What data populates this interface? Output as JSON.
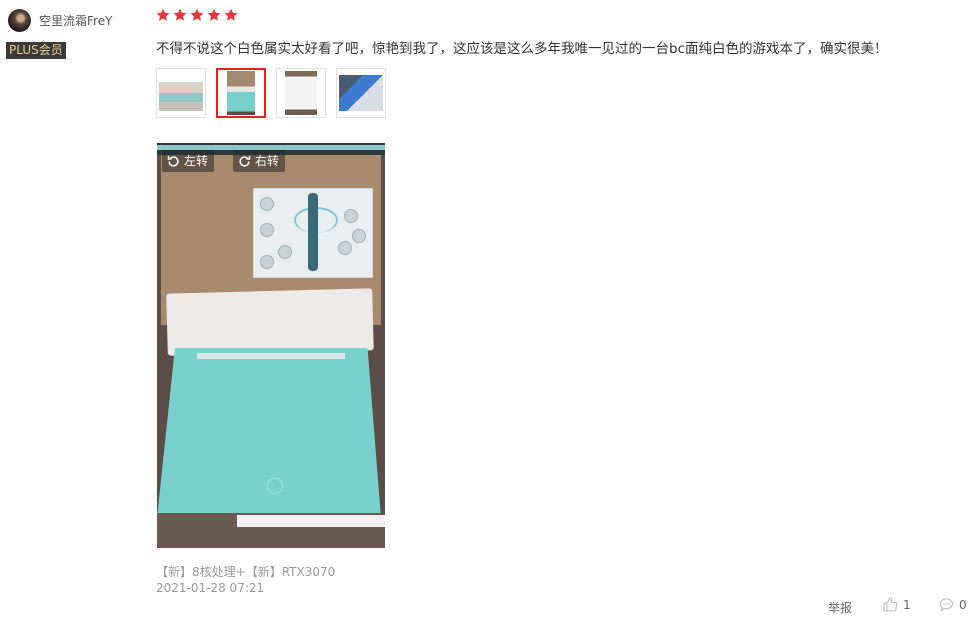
{
  "user": {
    "name": "空里流霜FreY",
    "badge": "PLUS会员"
  },
  "review": {
    "rating": 5,
    "rating_max": 5,
    "star_color": "#e4393c",
    "text": "不得不说这个白色属实太好看了吧，惊艳到我了，这应该是这么多年我唯一见过的一台bc面纯白色的游戏本了，确实很美！"
  },
  "gallery": {
    "thumbnail_count": 4,
    "active_index": 1,
    "active_border_color": "#e2231a",
    "rotate_left_label": "左转",
    "rotate_right_label": "右转"
  },
  "meta": {
    "spec": "【新】8核处理+【新】RTX3070",
    "date": "2021-01-28 07:21"
  },
  "actions": {
    "report_label": "举报",
    "like_count": "1",
    "reply_count": "0"
  }
}
